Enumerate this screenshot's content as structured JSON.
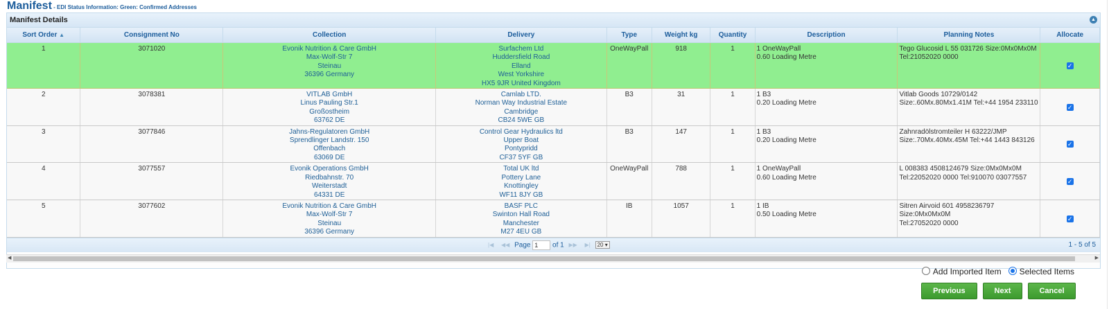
{
  "header": {
    "title": "Manifest",
    "subtitle": " - EDI Status Information: Green: Confirmed Addresses"
  },
  "panel": {
    "title": "Manifest Details",
    "collapse_icon": "chevron-up-icon"
  },
  "columns": [
    "Sort Order",
    "Consignment No",
    "Collection",
    "Delivery",
    "Type",
    "Weight kg",
    "Quantity",
    "Description",
    "Planning Notes",
    "Allocate"
  ],
  "rows": [
    {
      "sort": "1",
      "consignment": "3071020",
      "collection": [
        "Evonik Nutrition & Care GmbH",
        "Max-Wolf-Str 7",
        "Steinau",
        "36396 Germany"
      ],
      "delivery": [
        "Surfachem Ltd",
        "Huddersfield Road",
        "Elland",
        "West Yorkshire",
        "HX5 9JR United Kingdom"
      ],
      "type": "OneWayPall",
      "weight": "918",
      "quantity": "1",
      "description": [
        "1 OneWayPall",
        "0.60 Loading Metre"
      ],
      "notes": [
        "Tego Glucosid L 55 031726 Size:0Mx0Mx0M",
        "Tel:21052020 0000"
      ],
      "allocate": true,
      "confirmed": true
    },
    {
      "sort": "2",
      "consignment": "3078381",
      "collection": [
        "VITLAB GmbH",
        "Linus Pauling Str.1",
        "Großostheim",
        "63762 DE"
      ],
      "delivery": [
        "Camlab LTD.",
        "Norman Way Industrial Estate",
        "Cambridge",
        "CB24 5WE GB"
      ],
      "type": "B3",
      "weight": "31",
      "quantity": "1",
      "description": [
        "1 B3",
        "0.20 Loading Metre"
      ],
      "notes": [
        "Vitlab Goods 10729/0142",
        "Size:.60Mx.80Mx1.41M Tel:+44 1954 233110"
      ],
      "allocate": true,
      "confirmed": false
    },
    {
      "sort": "3",
      "consignment": "3077846",
      "collection": [
        "Jahns-Regulatoren GmbH",
        "Sprendlinger Landstr. 150",
        "Offenbach",
        "63069 DE"
      ],
      "delivery": [
        "Control Gear Hydraulics ltd",
        "Upper Boat",
        "Pontypridd",
        "CF37 5YF GB"
      ],
      "type": "B3",
      "weight": "147",
      "quantity": "1",
      "description": [
        "1 B3",
        "0.20 Loading Metre"
      ],
      "notes": [
        "Zahnradölstromteiler H 63222/JMP",
        "Size:.70Mx.40Mx.45M Tel:+44 1443 843126"
      ],
      "allocate": true,
      "confirmed": false
    },
    {
      "sort": "4",
      "consignment": "3077557",
      "collection": [
        "Evonik Operations GmbH",
        "Riedbahnstr. 70",
        "Weiterstadt",
        "64331 DE"
      ],
      "delivery": [
        "Total UK ltd",
        "Pottery Lane",
        "Knottingley",
        "WF11 8JY GB"
      ],
      "type": "OneWayPall",
      "weight": "788",
      "quantity": "1",
      "description": [
        "1 OneWayPall",
        "0.60 Loading Metre"
      ],
      "notes": [
        "L 008383 4508124679 Size:0Mx0Mx0M",
        "Tel:22052020 0000 Tel:910070 03077557"
      ],
      "allocate": true,
      "confirmed": false
    },
    {
      "sort": "5",
      "consignment": "3077602",
      "collection": [
        "Evonik Nutrition & Care GmbH",
        "Max-Wolf-Str 7",
        "Steinau",
        "36396 Germany"
      ],
      "delivery": [
        "BASF PLC",
        "Swinton Hall Road",
        "Manchester",
        "M27 4EU GB"
      ],
      "type": "IB",
      "weight": "1057",
      "quantity": "1",
      "description": [
        "1 IB",
        "0.50 Loading Metre"
      ],
      "notes": [
        "Sitren Airvoid 601 4958236797 Size:0Mx0Mx0M",
        "Tel:27052020 0000"
      ],
      "allocate": true,
      "confirmed": false
    }
  ],
  "pager": {
    "page_label": "Page",
    "page_value": "1",
    "of_label": "of 1",
    "page_size": "20",
    "range": "1 - 5 of 5"
  },
  "options": {
    "add_imported": "Add Imported Item",
    "selected_items": "Selected Items",
    "selected": "selected_items"
  },
  "buttons": {
    "previous": "Previous",
    "next": "Next",
    "cancel": "Cancel"
  },
  "colors": {
    "confirmed_row": "#90ee90",
    "button_green": "#4aa83a",
    "header_blue": "#1b5c9b"
  }
}
